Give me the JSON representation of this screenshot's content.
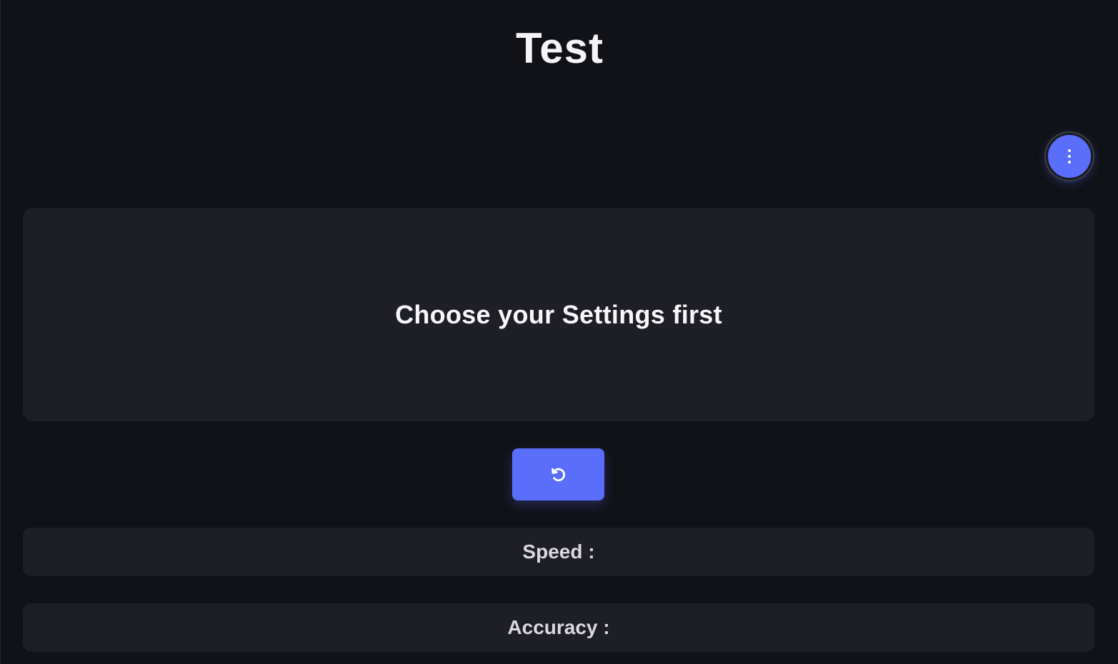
{
  "header": {
    "title": "Test"
  },
  "menu": {
    "icon": "more-vertical-icon"
  },
  "main": {
    "message": "Choose your Settings first"
  },
  "controls": {
    "restart_icon": "restart-icon"
  },
  "stats": {
    "speed_label": "Speed :",
    "accuracy_label": "Accuracy :"
  },
  "colors": {
    "background": "#111217",
    "card": "#1d1e26",
    "accent": "#5a6dfb",
    "text": "#f4f4f6"
  }
}
